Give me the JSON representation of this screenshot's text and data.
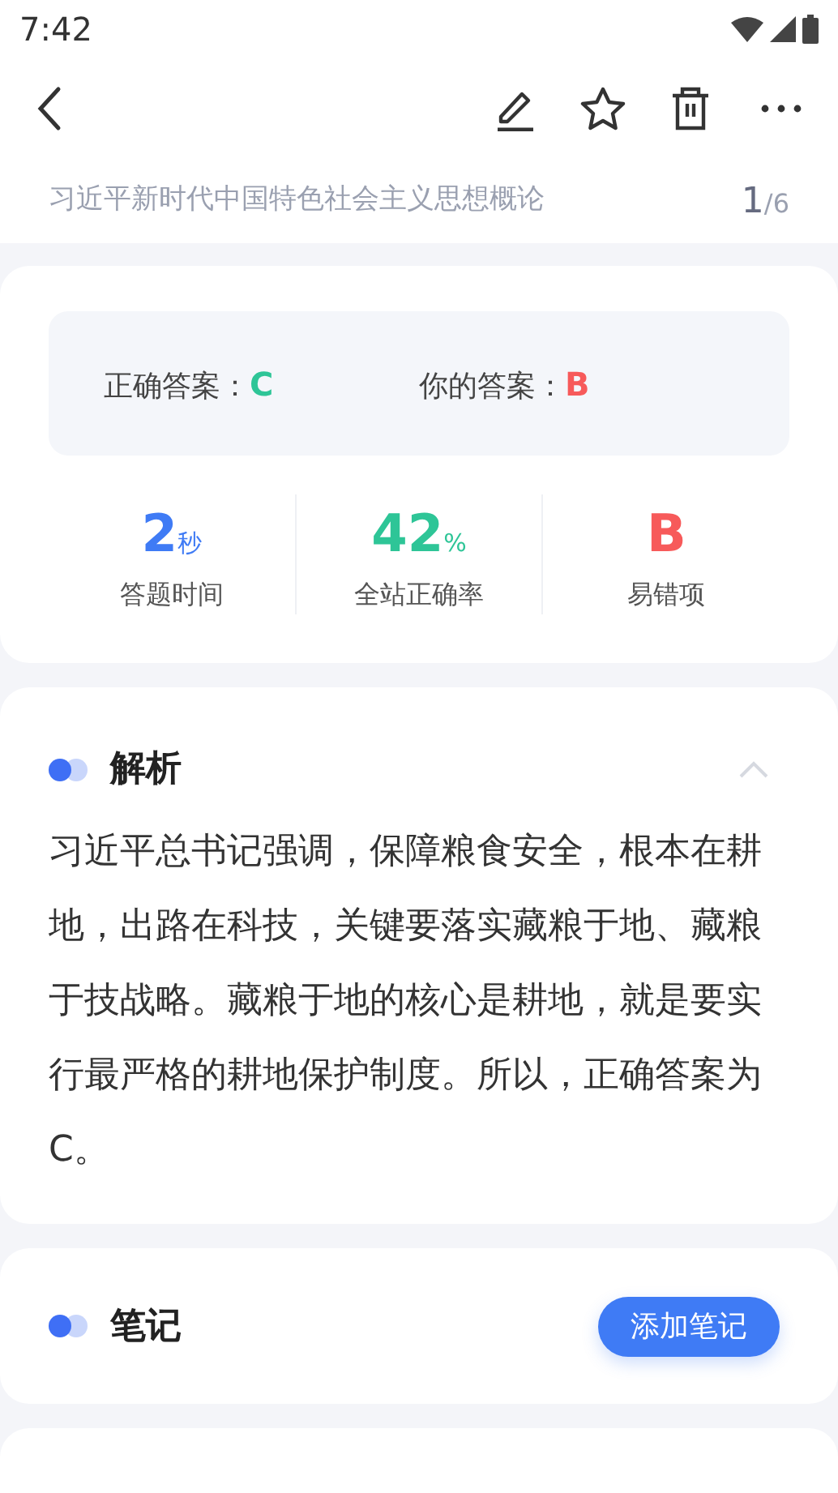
{
  "status_bar": {
    "time": "7:42"
  },
  "header": {
    "subject": "习近平新时代中国特色社会主义思想概论",
    "current": "1",
    "total": "/6"
  },
  "answers": [
    {
      "label": "正确答案：",
      "value": "C",
      "color": "#2ec597"
    },
    {
      "label": "你的答案：",
      "value": "B",
      "color": "#f75a5a"
    }
  ],
  "stats": [
    {
      "value": "2",
      "unit": "秒",
      "label": "答题时间",
      "color": "#3f7bf5"
    },
    {
      "value": "42",
      "unit": "%",
      "label": "全站正确率",
      "color": "#2ec597"
    },
    {
      "value": "B",
      "label": "易错项",
      "color": "#f75a5a"
    }
  ],
  "analysis": {
    "title": "解析",
    "expanded": true,
    "text": "习近平总书记强调，保障粮食安全，根本在耕地，出路在科技，关键要落实藏粮于地、藏粮于技战略。藏粮于地的核心是耕地，就是要实行最严格的耕地保护制度。所以，正确答案为C。"
  },
  "notes": {
    "title": "笔记",
    "button": "添加笔记"
  }
}
